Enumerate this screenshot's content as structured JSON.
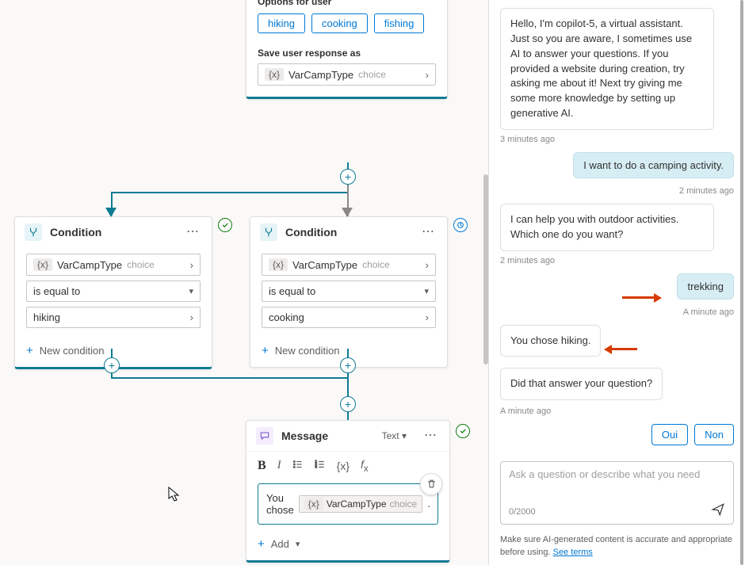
{
  "question_node": {
    "options_label": "Options for user",
    "options": [
      "hiking",
      "cooking",
      "fishing"
    ],
    "save_label": "Save user response as",
    "var_name": "VarCampType",
    "var_type": "choice"
  },
  "condition_left": {
    "title": "Condition",
    "var_name": "VarCampType",
    "var_type": "choice",
    "operator": "is equal to",
    "value": "hiking",
    "new_condition": "New condition"
  },
  "condition_right": {
    "title": "Condition",
    "var_name": "VarCampType",
    "var_type": "choice",
    "operator": "is equal to",
    "value": "cooking",
    "new_condition": "New condition"
  },
  "message_node": {
    "title": "Message",
    "text_menu": "Text",
    "prefix": "You chose",
    "var_name": "VarCampType",
    "var_type": "choice",
    "add_label": "Add"
  },
  "chat": {
    "intro": "Hello, I'm copilot-5, a virtual assistant. Just so you are aware, I sometimes use AI to answer your questions. If you provided a website during creation, try asking me about it! Next try giving me some more knowledge by setting up generative AI.",
    "ts1": "3 minutes ago",
    "user1": "I want to do a camping activity.",
    "ts2": "2 minutes ago",
    "bot2": "I can help you with outdoor activities. Which one do you want?",
    "ts3": "2 minutes ago",
    "user2": "trekking",
    "ts4": "A minute ago",
    "bot3": "You chose hiking.",
    "bot4": "Did that answer your question?",
    "ts5": "A minute ago",
    "qr": [
      "Oui",
      "Non"
    ],
    "placeholder": "Ask a question or describe what you need",
    "counter": "0/2000",
    "disclaimer_a": "Make sure AI-generated content is accurate and appropriate before using. ",
    "disclaimer_link": "See terms"
  }
}
